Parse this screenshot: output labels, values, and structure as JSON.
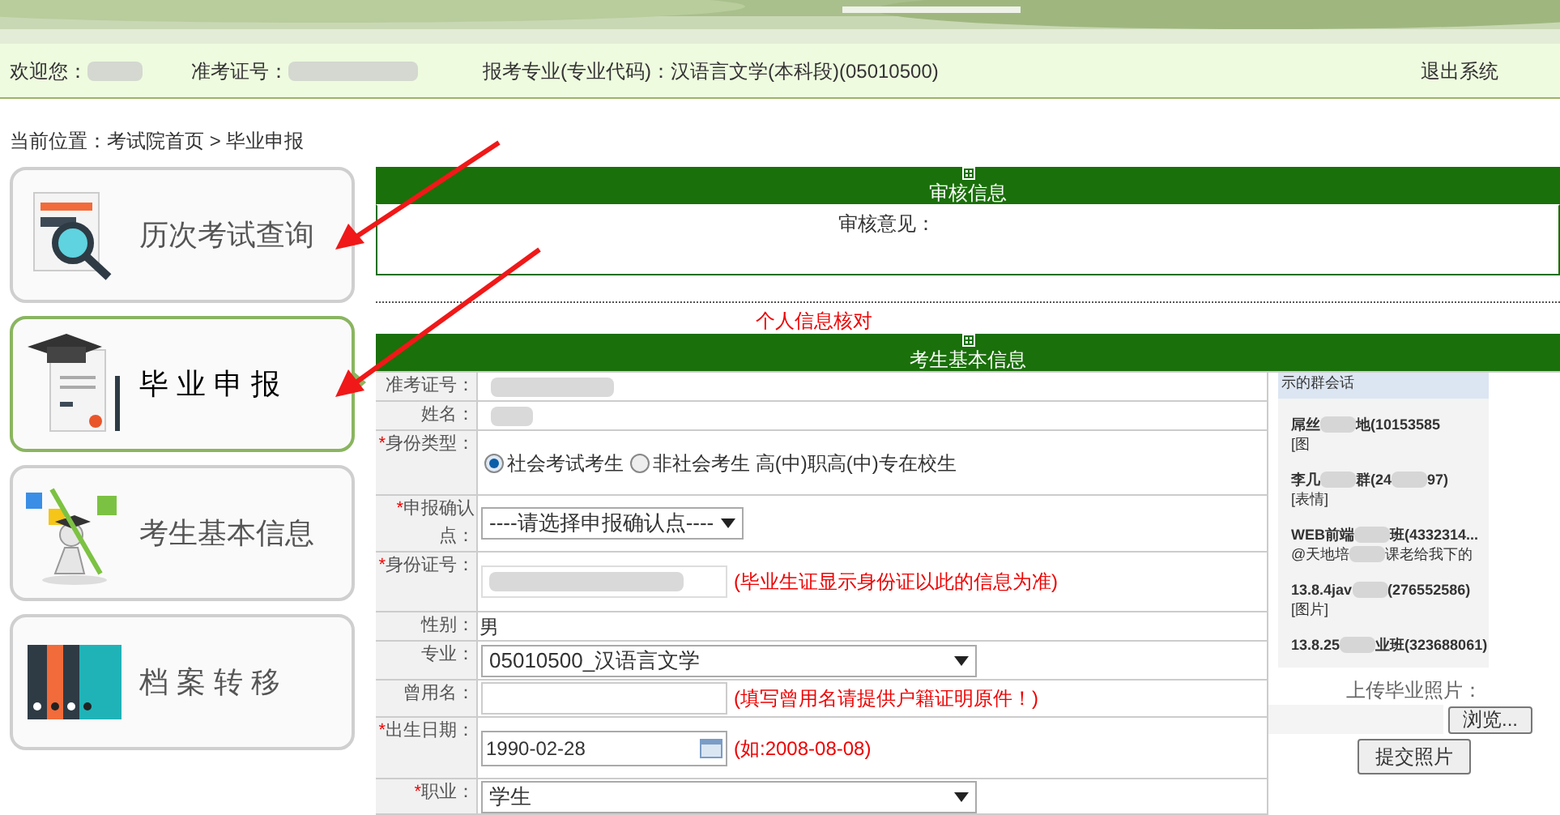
{
  "header": {
    "welcome_label": "欢迎您：",
    "exam_no_label": "准考证号：",
    "major": "报考专业(专业代码)：汉语言文学(本科段)(05010500)",
    "logout": "退出系统"
  },
  "breadcrumb": "当前位置：考试院首页 > 毕业申报",
  "sidebar": {
    "items": [
      {
        "label": "历次考试查询",
        "kind": "search",
        "selected": false
      },
      {
        "label": "毕 业 申 报",
        "kind": "graduate",
        "selected": true
      },
      {
        "label": "考生基本信息",
        "kind": "student",
        "selected": false
      },
      {
        "label": "档 案 转 移",
        "kind": "files",
        "selected": false
      }
    ]
  },
  "review": {
    "title": "审核信息",
    "opinion_label": "审核意见："
  },
  "section_note": "个人信息核对",
  "basic_info": {
    "title": "考生基本信息",
    "fields": [
      {
        "label": "准考证号：",
        "kind": "redacted"
      },
      {
        "label": "姓名：",
        "kind": "redacted"
      },
      {
        "label": "身份类型：",
        "required_mark": "*",
        "kind": "radio",
        "options": [
          {
            "label": "社会考试考生",
            "selected": true
          },
          {
            "label": "非社会考生 高(中)职高(中)专在校生",
            "selected": false
          }
        ]
      },
      {
        "label": "申报确认点：",
        "required_mark": "*",
        "kind": "select",
        "value": "----请选择申报确认点----"
      },
      {
        "label": "身份证号：",
        "required_mark": "*",
        "kind": "redacted_input",
        "note": "(毕业生证显示身份证以此的信息为准)"
      },
      {
        "label": "性别：",
        "kind": "plain",
        "value": "男"
      },
      {
        "label": "专业：",
        "kind": "select_wide",
        "value": "05010500_汉语言文学"
      },
      {
        "label": "曾用名：",
        "kind": "input",
        "note": "(填写曾用名请提供户籍证明原件！)"
      },
      {
        "label": "出生日期：",
        "required_mark": "*",
        "kind": "date",
        "value": "1990-02-28",
        "note": "(如:2008-08-08)"
      },
      {
        "label": "职业：",
        "required_mark": "*",
        "kind": "select_wide",
        "value": "学生"
      }
    ]
  },
  "photo": {
    "preview_header": "示的群会话",
    "preview_items": [
      {
        "title": [
          "屌丝",
          "地(10153585"
        ],
        "preview": [
          "[图"
        ]
      },
      {
        "title": [
          "李几",
          "群(24",
          "97)"
        ],
        "preview": [
          "[表情]"
        ]
      },
      {
        "title": [
          "WEB前端",
          "班(4332314..."
        ],
        "preview": [
          "@天地培",
          "课老给我下的"
        ]
      },
      {
        "title": [
          "13.8.4jav",
          "(276552586)"
        ],
        "preview": [
          "[图片]"
        ]
      },
      {
        "title": [
          "13.8.25",
          "业班(323688061)"
        ]
      }
    ],
    "upload_label": "上传毕业照片：",
    "browse_button": "浏览...",
    "submit_button": "提交照片"
  }
}
